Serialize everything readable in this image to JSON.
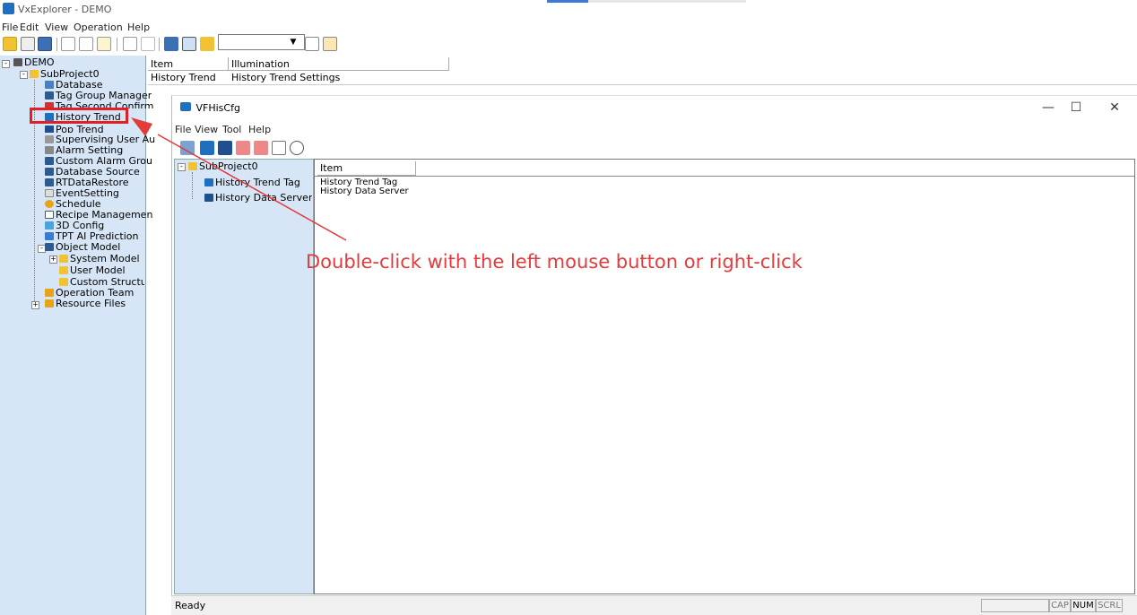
{
  "main": {
    "title": "VxExplorer - DEMO",
    "menu": [
      "File",
      "Edit",
      "View",
      "Operation",
      "Help"
    ]
  },
  "tree": {
    "root": "DEMO",
    "project": "SubProject0",
    "items": [
      "Database",
      "Tag Group Manager",
      "Tag Second Confirm",
      "History Trend",
      "Pop Trend",
      "Supervising User Au",
      "Alarm Setting",
      "Custom Alarm Grou",
      "Database Source",
      "RTDataRestore",
      "EventSetting",
      "Schedule",
      "Recipe Managemen",
      "3D Config",
      "TPT AI Prediction",
      "Object Model",
      "System Model",
      "User Model",
      "Custom Structur",
      "Operation Team",
      "Resource Files"
    ]
  },
  "top_table": {
    "headers": [
      "Item",
      "Illumination"
    ],
    "row": [
      "History Trend",
      "History Trend Settings"
    ]
  },
  "subwindow": {
    "title": "VFHisCfg",
    "menu": [
      "File",
      "View",
      "Tool",
      "Help"
    ],
    "tree_root": "SubProject0",
    "tree_items": [
      "History Trend Tag",
      "History Data Server"
    ],
    "list_header": "Item",
    "list_items": [
      "History Trend Tag",
      "History Data Server"
    ],
    "status": "Ready",
    "indicators": [
      "CAP",
      "NUM",
      "SCRL"
    ],
    "controls": {
      "minimize": "—",
      "maximize": "☐",
      "close": "✕"
    }
  },
  "annotation": "Double-click with the left mouse button or right-click",
  "colors": {
    "highlight": "#e31e24",
    "annotation": "#e23b3b",
    "tree_bg": "#d6e6f6",
    "accent": "#1f6fc0"
  }
}
